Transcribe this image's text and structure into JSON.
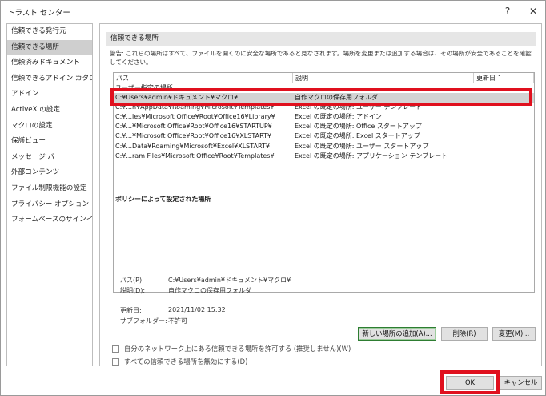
{
  "window": {
    "title": "トラスト センター",
    "help_label": "?",
    "close_label": "✕"
  },
  "sidebar": {
    "items": [
      {
        "label": "信頼できる発行元",
        "selected": false
      },
      {
        "label": "信頼できる場所",
        "selected": true
      },
      {
        "label": "信頼済みドキュメント",
        "selected": false
      },
      {
        "label": "信頼できるアドイン カタログ",
        "selected": false
      },
      {
        "label": "アドイン",
        "selected": false
      },
      {
        "label": "ActiveX の設定",
        "selected": false
      },
      {
        "label": "マクロの設定",
        "selected": false
      },
      {
        "label": "保護ビュー",
        "selected": false
      },
      {
        "label": "メッセージ バー",
        "selected": false
      },
      {
        "label": "外部コンテンツ",
        "selected": false
      },
      {
        "label": "ファイル制限機能の設定",
        "selected": false
      },
      {
        "label": "プライバシー オプション",
        "selected": false
      },
      {
        "label": "フォームベースのサインイン",
        "selected": false
      }
    ]
  },
  "main": {
    "section_title": "信頼できる場所",
    "warning": "警告: これらの場所はすべて、ファイルを開くのに安全な場所であると見なされます。場所を変更または追加する場合は、その場所が安全であることを確認してください。",
    "columns": {
      "path": "パス",
      "description": "説明",
      "modified": "更新日 ˇ"
    },
    "user_group_label": "ユーザー指定の場所",
    "rows": [
      {
        "path": "C:¥Users¥admin¥ドキュメント¥マクロ¥",
        "description": "自作マクロの保存用フォルダ",
        "selected": true
      },
      {
        "path": "C:¥...n¥AppData¥Roaming¥Microsoft¥Templates¥",
        "description": "Excel の既定の場所: ユーザー テンプレート",
        "selected": false
      },
      {
        "path": "C:¥...les¥Microsoft Office¥Root¥Office16¥Library¥",
        "description": "Excel の既定の場所: アドイン",
        "selected": false
      },
      {
        "path": "C:¥...¥Microsoft Office¥Root¥Office16¥STARTUP¥",
        "description": "Excel の既定の場所: Office スタートアップ",
        "selected": false
      },
      {
        "path": "C:¥...¥Microsoft Office¥Root¥Office16¥XLSTART¥",
        "description": "Excel の既定の場所: Excel スタートアップ",
        "selected": false
      },
      {
        "path": "C:¥...Data¥Roaming¥Microsoft¥Excel¥XLSTART¥",
        "description": "Excel の既定の場所: ユーザー スタートアップ",
        "selected": false
      },
      {
        "path": "C:¥...ram Files¥Microsoft Office¥Root¥Templates¥",
        "description": "Excel の既定の場所: アプリケーション テンプレート",
        "selected": false
      }
    ],
    "policy_group_label": "ポリシーによって設定された場所",
    "details": {
      "path_label": "パス(P):",
      "path_value": "C:¥Users¥admin¥ドキュメント¥マクロ¥",
      "desc_label": "説明(D):",
      "desc_value": "自作マクロの保存用フォルダ",
      "date_label": "更新日:",
      "date_value": "2021/11/02 15:32",
      "subfolder_label": "サブフォルダー:",
      "subfolder_value": "不許可"
    },
    "buttons": {
      "add": "新しい場所の追加(A)...",
      "remove": "削除(R)",
      "modify": "変更(M)..."
    },
    "checkboxes": {
      "network": "自分のネットワーク上にある信頼できる場所を許可する (推奨しません)(W)",
      "disable_all": "すべての信頼できる場所を無効にする(D)"
    }
  },
  "footer": {
    "ok": "OK",
    "cancel": "キャンセル"
  },
  "colors": {
    "highlight_red": "#e0101e",
    "selected_row": "#d3d3d3",
    "section_header": "#e6e6e6"
  }
}
